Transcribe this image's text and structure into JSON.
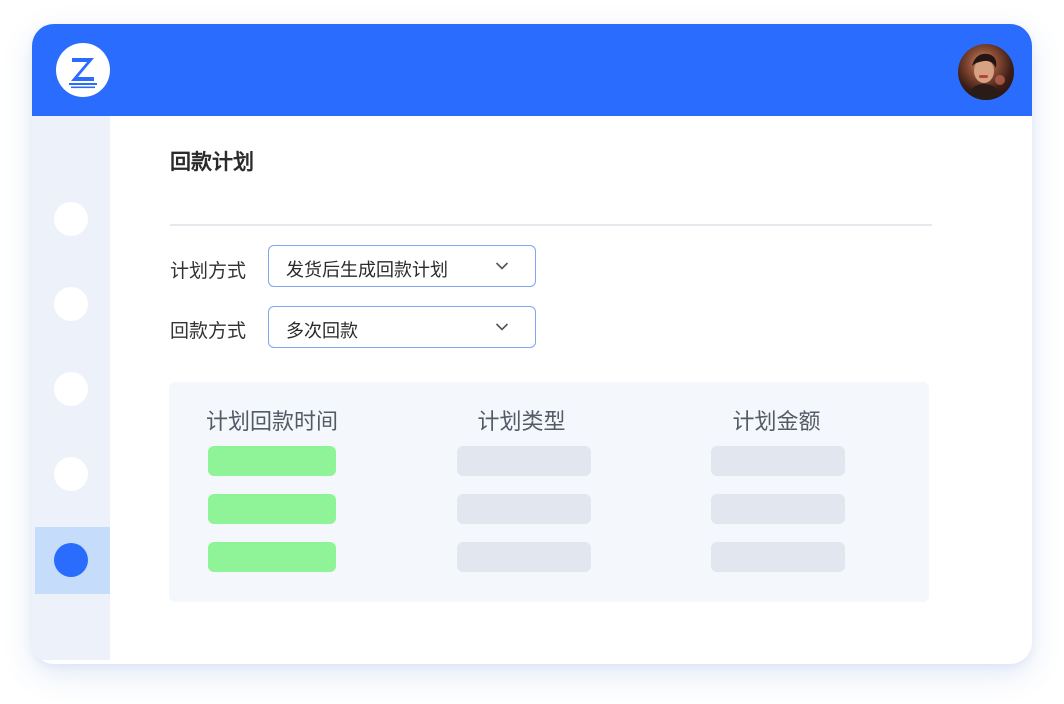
{
  "header": {
    "logo_icon": "z-logo-icon",
    "avatar_icon": "user-avatar",
    "brand_color": "#2a6cfd"
  },
  "sidebar": {
    "items": [
      {
        "icon": "nav-circle-icon",
        "active": false
      },
      {
        "icon": "nav-circle-icon",
        "active": false
      },
      {
        "icon": "nav-circle-icon",
        "active": false
      },
      {
        "icon": "nav-circle-icon",
        "active": false
      },
      {
        "icon": "nav-circle-icon",
        "active": true
      }
    ],
    "active_color": "#2a6cfd"
  },
  "main": {
    "title": "回款计划",
    "fields": [
      {
        "label": "计划方式",
        "value": "发货后生成回款计划"
      },
      {
        "label": "回款方式",
        "value": "多次回款"
      }
    ],
    "table": {
      "headers": [
        "计划回款时间",
        "计划类型",
        "计划金额"
      ],
      "row_count": 3,
      "placeholder_colors": [
        "#8ef497",
        "#e2e7ef",
        "#e2e7ef"
      ]
    }
  }
}
